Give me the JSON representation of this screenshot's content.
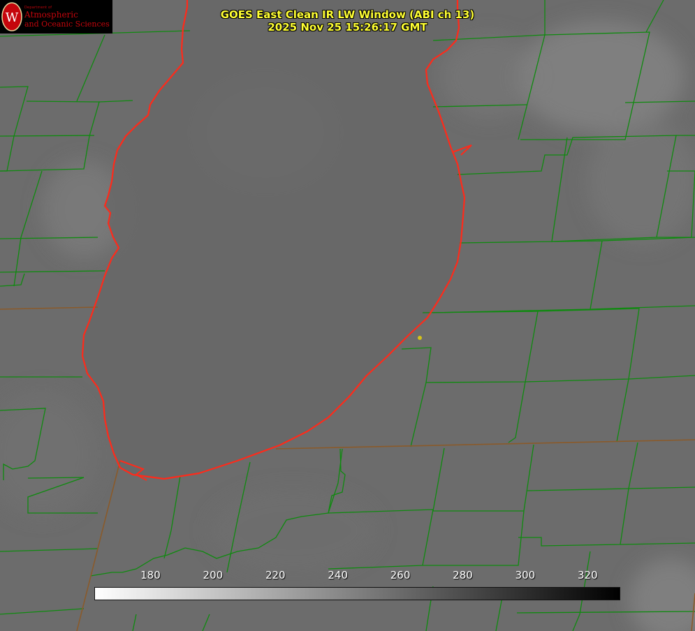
{
  "header": {
    "title": "GOES East Clean IR LW Window (ABI ch 13)",
    "timestamp": "2025 Nov 25 15:26:17 GMT"
  },
  "logo": {
    "department": "Department of",
    "line1": "Atmospheric",
    "line2": "and Oceanic Sciences",
    "seal_letter": "W"
  },
  "colorbar": {
    "ticks": [
      "180",
      "200",
      "220",
      "240",
      "260",
      "280",
      "300",
      "320"
    ],
    "tick_values": [
      180,
      200,
      220,
      240,
      260,
      280,
      300,
      320
    ],
    "range": [
      162,
      330
    ]
  },
  "colors": {
    "title": "#ffff33",
    "shoreline": "#ff2a1a",
    "county_borders": "#0f8a0f",
    "marker": "#d4c21a",
    "logo_red": "#c5050c"
  }
}
